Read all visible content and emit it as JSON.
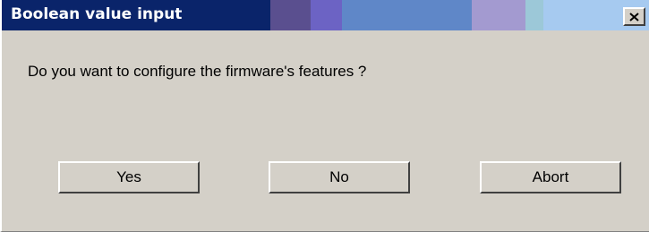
{
  "window": {
    "title": "Boolean value input",
    "close_glyph": "close-icon"
  },
  "message": "Do you want to configure the firmware's features ?",
  "buttons": {
    "yes": "Yes",
    "no": "No",
    "abort": "Abort"
  },
  "colors": {
    "titlebar_start": "#0a246a",
    "titlebar_end": "#a6caf0",
    "face": "#d4d0c8"
  }
}
